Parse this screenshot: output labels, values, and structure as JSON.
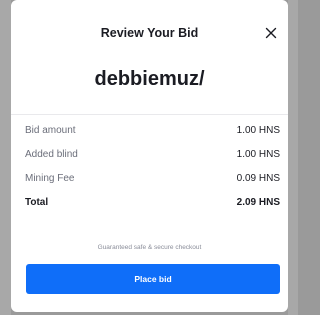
{
  "modal": {
    "title": "Review Your Bid",
    "close_icon": "close-icon",
    "domain": "debbiemuz/",
    "rows": [
      {
        "label": "Bid amount",
        "value": "1.00 HNS"
      },
      {
        "label": "Added blind",
        "value": "1.00 HNS"
      },
      {
        "label": "Mining Fee",
        "value": "0.09 HNS"
      }
    ],
    "total": {
      "label": "Total",
      "value": "2.09 HNS"
    },
    "guarantee_text": "Guaranteed safe & secure checkout",
    "primary_button_label": "Place bid"
  },
  "colors": {
    "accent": "#0f6ef9",
    "text_primary": "#1b1c23",
    "text_secondary": "#6b6e7a",
    "backdrop": "#9a9a9a"
  }
}
